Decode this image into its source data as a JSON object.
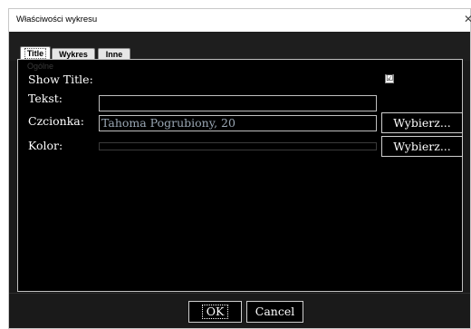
{
  "window": {
    "title": "Właściwości wykresu",
    "close_glyph": "✕"
  },
  "tabs": [
    {
      "label": "Title",
      "active": true
    },
    {
      "label": "Wykres",
      "active": false
    },
    {
      "label": "Inne",
      "active": false
    }
  ],
  "panel": {
    "group_label": "Ogólne",
    "show_title": {
      "label": "Show Title:",
      "checked": true,
      "check_glyph": "☑"
    },
    "text": {
      "label": "Tekst:",
      "value": ""
    },
    "font": {
      "label": "Czcionka:",
      "value": "Tahoma Pogrubiony, 20",
      "choose_label": "Wybierz..."
    },
    "color": {
      "label": "Kolor:",
      "value_color": "#000000",
      "choose_label": "Wybierz..."
    }
  },
  "footer": {
    "ok_label": "OK",
    "cancel_label": "Cancel"
  },
  "colors": {
    "background": "#1a1a1a",
    "panel": "#000000",
    "border": "#c0c0c0",
    "font_value": "#9aa7b4"
  }
}
